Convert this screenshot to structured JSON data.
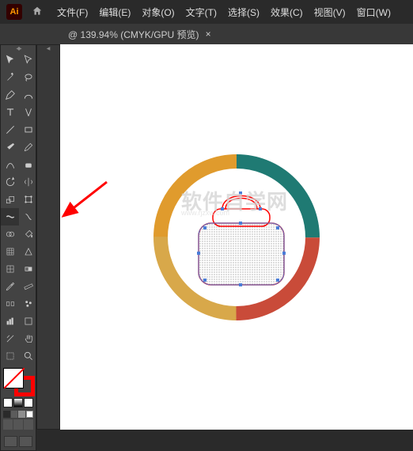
{
  "app": {
    "logo_text": "Ai"
  },
  "menubar": [
    {
      "label": "文件(F)"
    },
    {
      "label": "编辑(E)"
    },
    {
      "label": "对象(O)"
    },
    {
      "label": "文字(T)"
    },
    {
      "label": "选择(S)"
    },
    {
      "label": "效果(C)"
    },
    {
      "label": "视图(V)"
    },
    {
      "label": "窗口(W)"
    }
  ],
  "tab": {
    "title": "@ 139.94% (CMYK/GPU 预览)",
    "close": "×"
  },
  "tools": {
    "selection": "selection-tool",
    "direct_selection": "direct-selection-tool",
    "magic_wand": "magic-wand-tool",
    "lasso": "lasso-tool",
    "pen": "pen-tool",
    "curvature": "curvature-tool",
    "type": "type-tool",
    "touch_type": "touch-type-tool",
    "line": "line-segment-tool",
    "rectangle": "rectangle-tool",
    "paintbrush": "paintbrush-tool",
    "pencil": "pencil-tool",
    "shaper": "shaper-tool",
    "eraser": "eraser-tool",
    "rotate": "rotate-tool",
    "reflect": "reflect-tool",
    "scale": "scale-tool",
    "free_transform": "free-transform-tool",
    "width": "width-tool",
    "warp": "warp-tool",
    "shape_builder": "shape-builder-tool",
    "live_paint": "live-paint-bucket-tool",
    "perspective_grid": "perspective-grid-tool",
    "perspective_selection": "perspective-selection-tool",
    "mesh": "mesh-tool",
    "gradient": "gradient-tool",
    "eyedropper": "eyedropper-tool",
    "measure": "measure-tool",
    "blend": "blend-tool",
    "symbol_sprayer": "symbol-sprayer-tool",
    "column_graph": "column-graph-tool",
    "artboard": "artboard-tool",
    "slice": "slice-tool",
    "hand": "hand-tool",
    "print_tiling": "print-tiling-tool",
    "zoom": "zoom-tool"
  },
  "colors": {
    "fill": "none",
    "stroke": "#ff0000",
    "swatches": [
      "#2a2a2a",
      "#5c5c5c",
      "#8e8e8e",
      "#ffffff"
    ]
  },
  "ring": {
    "top_left": "#e09b2d",
    "top_right": "#1f7a73",
    "bottom_right": "#c94b39",
    "bottom_left": "#d8a84a"
  },
  "watermark": {
    "main": "软件自学网",
    "sub": "www.rjzxw.com"
  }
}
